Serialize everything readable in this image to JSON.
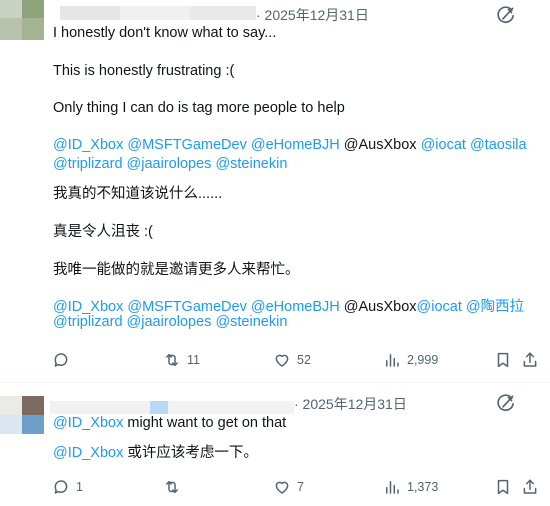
{
  "colors": {
    "link": "#1d9bf0",
    "text": "#0f1419",
    "muted": "#536471",
    "border": "#eff3f4"
  },
  "tweet1": {
    "timestamp": "· 2025年12月31日",
    "lines": {
      "l1": "I honestly don't know what to say...",
      "l2": "This is honestly frustrating :(",
      "l3": "Only thing I can do is tag more people to help",
      "l8": "我真的不知道该说什么......",
      "l9": "真是令人沮丧 :(",
      "l10": "我唯一能做的就是邀请更多人来帮忙。"
    },
    "mentions_en": {
      "m1": "@ID_Xbox",
      "m2": "@MSFTGameDev",
      "m3": "@eHomeBJH",
      "m4": "@AusXbox",
      "m5": "@iocat",
      "m6": "@taosila",
      "m7": "@triplizard",
      "m8": "@jaairolopes",
      "m9": "@steinekin"
    },
    "mentions_zh": {
      "m1": "@ID_Xbox",
      "m2": "@MSFTGameDev",
      "m3": "@eHomeBJH",
      "m4": "@AusXbox",
      "m5": "@iocat",
      "m6": "@陶西拉",
      "m7": "@triplizard",
      "m8": "@jaairolopes",
      "m9": "@steinekin"
    },
    "stats": {
      "replies": "",
      "retweets": "11",
      "likes": "52",
      "views": "2,999"
    }
  },
  "tweet2": {
    "timestamp": "· 2025年12月31日",
    "mention": "@ID_Xbox",
    "line1_rest": " might want to get on that",
    "line2_rest": " 或许应该考虑一下。",
    "stats": {
      "replies": "1",
      "retweets": "",
      "likes": "7",
      "views": "1,373"
    }
  },
  "icons": [
    "grok-icon",
    "reply-icon",
    "retweet-icon",
    "like-icon",
    "views-icon",
    "bookmark-icon",
    "share-icon"
  ]
}
